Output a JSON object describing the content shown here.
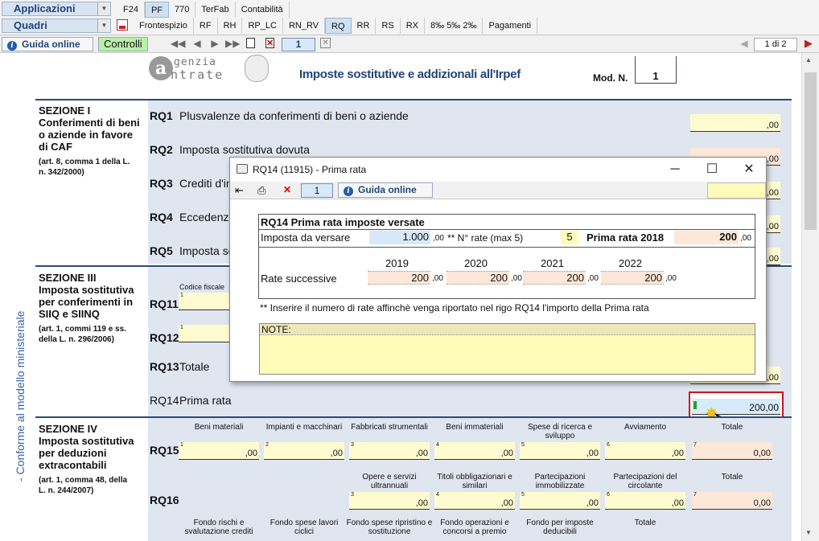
{
  "topbar": {
    "applicazioni": "Applicazioni",
    "quadri": "Quadri",
    "tabs_row1": [
      "F24",
      "PF",
      "770",
      "TerFab",
      "Contabilità"
    ],
    "active_row1": "PF",
    "tabs_row2": [
      "Frontespizio",
      "RF",
      "RH",
      "RP_LC",
      "RN_RV",
      "RQ",
      "RR",
      "RS",
      "RX",
      "8‰ 5‰ 2‰",
      "Pagamenti"
    ],
    "active_row2": "RQ"
  },
  "toolbar": {
    "guida": "Guida online",
    "controlli": "Controlli",
    "module_num": "1",
    "pages": "1 di 2"
  },
  "header": {
    "agenzia": "genzia",
    "entrate": "ntrate",
    "title": "Imposte sostitutive e addizionali all'Irpef",
    "mod_label": "Mod. N.",
    "mod_num": "1"
  },
  "side_label": "- Conforme al modello ministeriale",
  "sections": {
    "s1_title": "SEZIONE I",
    "s1_desc": "Conferimenti di beni o aziende in favore di CAF",
    "s1_ref": "(art. 8, comma 1 della L. n. 342/2000)",
    "s3_title": "SEZIONE III",
    "s3_desc": "Imposta sostitutiva per conferimenti in SIIQ e SIINQ",
    "s3_ref": "(art. 1, commi 119 e ss. della L. n. 296/2006)",
    "s4_title": "SEZIONE IV",
    "s4_desc": "Imposta sostitutiva per deduzioni extracontabili",
    "s4_ref": "(art. 1, comma 48, della L. n. 244/2007)"
  },
  "rows": {
    "rq1": "RQ1",
    "rq1_lbl": "Plusvalenze da conferimenti di beni o aziende",
    "rq2": "RQ2",
    "rq2_lbl": "Imposta sostitutiva dovuta",
    "rq3": "RQ3",
    "rq3_lbl": "Crediti d'in",
    "rq4": "RQ4",
    "rq4_lbl": "Eccedenza",
    "rq5": "RQ5",
    "rq5_lbl": "Imposta so",
    "rq11": "RQ11",
    "rq11_lbl": "Codice fiscale",
    "rq12": "RQ12",
    "rq13": "RQ13",
    "rq13_lbl": "Totale",
    "rq14": "RQ14",
    "rq14_lbl": "Prima rata",
    "rq14_val": "200",
    "rq15": "RQ15",
    "rq16": "RQ16"
  },
  "decimals": ",00",
  "decimals_total": "0,00",
  "rq15_headers": [
    "Beni materiali",
    "Impianti e macchinari",
    "Fabbricati strumentali",
    "Beni immateriali",
    "Spese di ricerca e sviluppo",
    "Avviamento",
    "Totale"
  ],
  "rq16_headers": [
    "Opere e servizi ultrannuali",
    "Titoli obbligazionari e similari",
    "Partecipazioni immobilizzate",
    "Partecipazioni del circolante",
    "Totale"
  ],
  "rq17_headers": [
    "Fondo rischi e svalutazione crediti",
    "Fondo spese lavori ciclici",
    "Fondo spese ripristino e sostituzione",
    "Fondo operazioni e concorsi a premio",
    "Fondo per imposte deducibili",
    "Totale"
  ],
  "modal": {
    "title": "RQ14 (11915) - Prima rata",
    "num": "1",
    "guida": "Guida online",
    "box_title": "RQ14 Prima rata imposte versate",
    "imposta_lbl": "Imposta da versare",
    "imposta_val": "1.000",
    "dec": ",00",
    "nrate_lbl": "** N° rate (max 5)",
    "nrate_val": "5",
    "prima_lbl": "Prima rata 2018",
    "prima_val": "200",
    "rate_lbl": "Rate successive",
    "years": [
      "2019",
      "2020",
      "2021",
      "2022"
    ],
    "rate_vals": [
      "200",
      "200",
      "200",
      "200"
    ],
    "note_foot": "** Inserire il numero di rate affinchè venga riportato nel rigo RQ14  l'importo della Prima rata",
    "note_lbl": "NOTE:"
  }
}
